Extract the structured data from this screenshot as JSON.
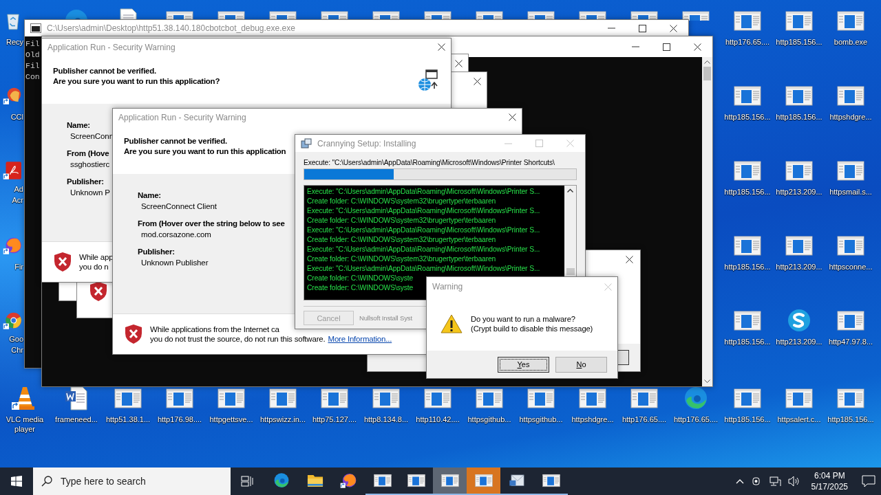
{
  "console_back": {
    "title": "C:\\Users\\admin\\Desktop\\http51.38.140.180cbotcbot_debug.exe.exe",
    "lines": [
      "Fil",
      "Old",
      "Fil",
      "Con"
    ]
  },
  "dialog_back": {
    "title": "Application Run - Security Warning",
    "heading": [
      "Publisher cannot be verified.",
      "Are you sure you want to run this application?"
    ],
    "fields": [
      {
        "label": "Name:",
        "value": "ScreenConn"
      },
      {
        "label": "From (Hove",
        "value": "ssghostierc"
      },
      {
        "label": "Publisher:",
        "value": "Unknown P"
      }
    ],
    "footer": [
      "While app",
      "you do n"
    ]
  },
  "dialog_front": {
    "title": "Application Run - Security Warning",
    "heading": [
      "Publisher cannot be verified.",
      "Are you sure you want to run this application"
    ],
    "fields": [
      {
        "label": "Name:",
        "value": "ScreenConnect Client"
      },
      {
        "label": "From (Hover over the string below to see",
        "value": "mod.corsazone.com"
      },
      {
        "label": "Publisher:",
        "value": "Unknown Publisher"
      }
    ],
    "footer": [
      "While applications from the Internet ca",
      "you do not trust the source, do not run this software."
    ],
    "link": "More Information..."
  },
  "installer": {
    "title": "Crannying Setup: Installing",
    "status": "Execute: \"C:\\Users\\admin\\AppData\\Roaming\\Microsoft\\Windows\\Printer Shortcuts\\",
    "progress": {
      "level": 0.33
    },
    "log": [
      "Execute: \"C:\\Users\\admin\\AppData\\Roaming\\Microsoft\\Windows\\Printer S...",
      "Create folder: C:\\WINDOWS\\system32\\brugertyper\\terbaaren",
      "Execute: \"C:\\Users\\admin\\AppData\\Roaming\\Microsoft\\Windows\\Printer S...",
      "Create folder: C:\\WINDOWS\\system32\\brugertyper\\terbaaren",
      "Execute: \"C:\\Users\\admin\\AppData\\Roaming\\Microsoft\\Windows\\Printer S...",
      "Create folder: C:\\WINDOWS\\system32\\brugertyper\\terbaaren",
      "Execute: \"C:\\Users\\admin\\AppData\\Roaming\\Microsoft\\Windows\\Printer S...",
      "Create folder: C:\\WINDOWS\\system32\\brugertyper\\terbaaren",
      "Execute: \"C:\\Users\\admin\\AppData\\Roaming\\Microsoft\\Windows\\Printer S...",
      "Create folder: C:\\WINDOWS\\syste",
      "Create folder: C:\\WINDOWS\\syste"
    ],
    "cancel_button": {
      "label": "Cancel",
      "disabled": true
    },
    "branding": "Nullsoft Install Syst"
  },
  "warning": {
    "title": "Warning",
    "message": [
      "Do you want to run a malware?",
      "(Crypt build to disable this message)"
    ],
    "buttons": [
      {
        "label": "Yes",
        "focused": true
      },
      {
        "label": "No",
        "focused": false
      }
    ]
  },
  "desktop_icons": {
    "left_column": [
      {
        "kind": "recycle",
        "lines": [
          "Recy"
        ]
      },
      {
        "kind": "ccleaner",
        "lines": [
          "CCl"
        ]
      },
      {
        "kind": "acrobat",
        "lines": [
          "Ad",
          "Acr"
        ]
      },
      {
        "kind": "firefox",
        "lines": [
          "Fir"
        ]
      },
      {
        "kind": "chrome",
        "lines": [
          "Goo",
          "Chr"
        ]
      },
      {
        "kind": "vlc",
        "lines": [
          "VLC media player"
        ]
      }
    ],
    "top_row": [
      {
        "kind": "edge"
      },
      {
        "kind": "document"
      },
      {
        "kind": "page"
      },
      {
        "kind": "page"
      },
      {
        "kind": "page"
      },
      {
        "kind": "page"
      },
      {
        "kind": "page"
      },
      {
        "kind": "page"
      },
      {
        "kind": "page"
      },
      {
        "kind": "page"
      },
      {
        "kind": "page"
      },
      {
        "kind": "page"
      },
      {
        "kind": "page"
      }
    ],
    "bottom_row": [
      {
        "kind": "word",
        "lines": [
          "frameneed..."
        ]
      },
      {
        "kind": "page",
        "lines": [
          "http51.38.1..."
        ]
      },
      {
        "kind": "page",
        "lines": [
          "http176.98...."
        ]
      },
      {
        "kind": "page",
        "lines": [
          "httpgettsve..."
        ]
      },
      {
        "kind": "page",
        "lines": [
          "httpswizz.in..."
        ]
      },
      {
        "kind": "page",
        "lines": [
          "http75.127...."
        ]
      },
      {
        "kind": "page",
        "lines": [
          "http8.134.8..."
        ]
      },
      {
        "kind": "page",
        "lines": [
          "http110.42...."
        ]
      },
      {
        "kind": "page",
        "lines": [
          "httpsgithub..."
        ]
      },
      {
        "kind": "page",
        "lines": [
          "httpsgithub..."
        ]
      },
      {
        "kind": "page",
        "lines": [
          "httpshdgre..."
        ]
      },
      {
        "kind": "page",
        "lines": [
          "http176.65...."
        ]
      },
      {
        "kind": "edge",
        "lines": [
          "http176.65...."
        ]
      }
    ],
    "right_columns": [
      [
        {
          "kind": "page",
          "lines": [
            "http176.65...."
          ]
        },
        {
          "kind": "page",
          "lines": [
            "http185.156..."
          ]
        },
        {
          "kind": "page",
          "lines": [
            "http185.156..."
          ]
        },
        {
          "kind": "page",
          "lines": [
            "http185.156..."
          ]
        },
        {
          "kind": "page",
          "lines": [
            "http185.156..."
          ]
        },
        {
          "kind": "page",
          "lines": [
            "http185.156..."
          ]
        }
      ],
      [
        {
          "kind": "page",
          "lines": [
            "http185.156..."
          ]
        },
        {
          "kind": "page",
          "lines": [
            "http185.156..."
          ]
        },
        {
          "kind": "page",
          "lines": [
            "http213.209..."
          ]
        },
        {
          "kind": "page",
          "lines": [
            "http213.209..."
          ]
        },
        {
          "kind": "skype",
          "lines": [
            "http213.209..."
          ]
        },
        {
          "kind": "page",
          "lines": [
            "httpsalert.c..."
          ]
        }
      ],
      [
        {
          "kind": "page",
          "lines": [
            "bomb.exe"
          ]
        },
        {
          "kind": "page",
          "lines": [
            "httpshdgre..."
          ]
        },
        {
          "kind": "page",
          "lines": [
            "httpsmail.s..."
          ]
        },
        {
          "kind": "page",
          "lines": [
            "httpsconne..."
          ]
        },
        {
          "kind": "page",
          "lines": [
            "http47.97.8..."
          ]
        },
        {
          "kind": "page",
          "lines": [
            "http185.156..."
          ]
        }
      ]
    ]
  },
  "taskbar": {
    "search": {
      "placeholder": "Type here to search"
    },
    "items": [
      {
        "kind": "edge",
        "running": false,
        "selected": false,
        "flashing": false
      },
      {
        "kind": "folder",
        "running": false,
        "selected": false,
        "flashing": false
      },
      {
        "kind": "firefox",
        "running": false,
        "selected": false,
        "flashing": false
      },
      {
        "kind": "page",
        "running": true,
        "selected": false,
        "flashing": false
      },
      {
        "kind": "page",
        "running": true,
        "selected": false,
        "flashing": false
      },
      {
        "kind": "page",
        "running": true,
        "selected": true,
        "flashing": false
      },
      {
        "kind": "page",
        "running": true,
        "selected": false,
        "flashing": true
      },
      {
        "kind": "mail",
        "running": true,
        "selected": false,
        "flashing": false
      },
      {
        "kind": "page",
        "running": true,
        "selected": false,
        "flashing": false
      }
    ],
    "clock": {
      "time": "6:04 PM",
      "date": "5/17/2025"
    }
  }
}
